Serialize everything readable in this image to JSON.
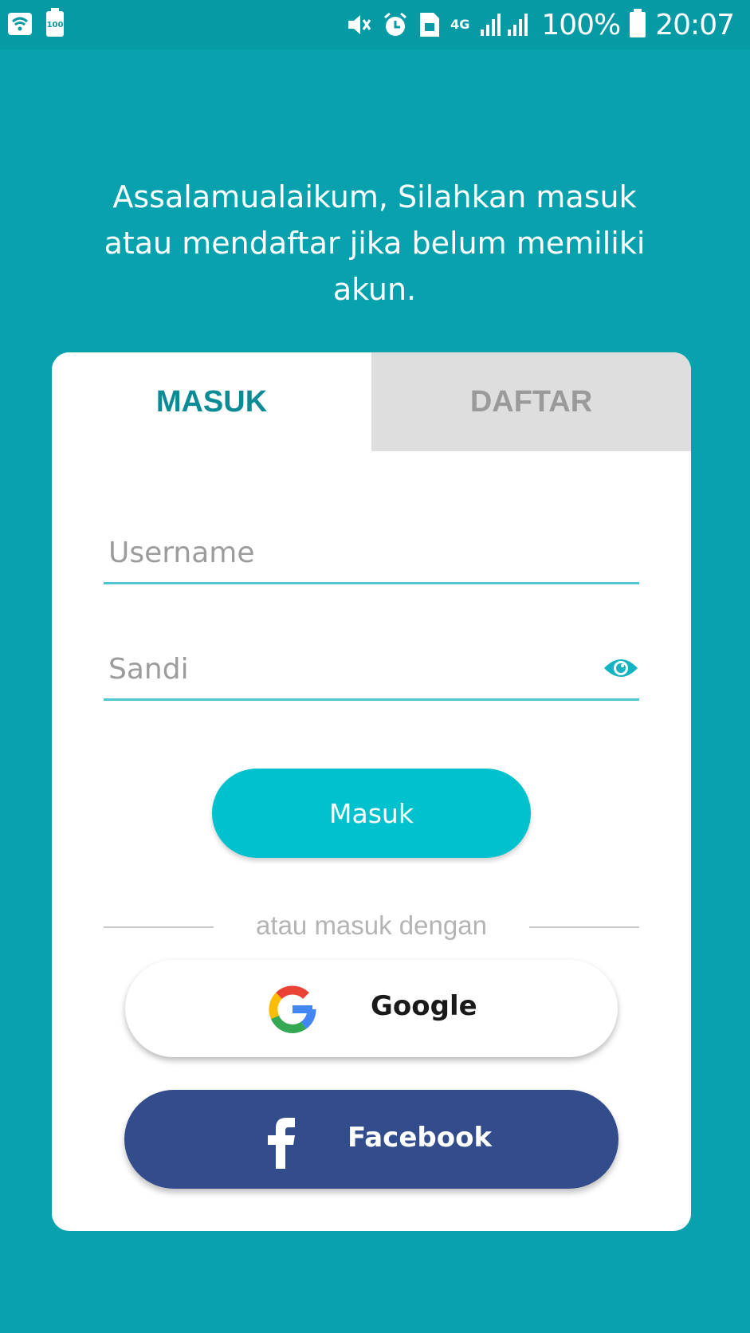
{
  "status_bar": {
    "battery_small": "100",
    "network": "4G",
    "battery_percent": "100%",
    "time": "20:07",
    "icons": [
      "wifi-icon",
      "battery-saver-icon",
      "mute-icon",
      "alarm-icon",
      "sim-card-icon",
      "signal-icon",
      "battery-icon"
    ]
  },
  "welcome_text": "Assalamualaikum, Silahkan masuk atau mendaftar jika belum memiliki akun.",
  "tabs": [
    {
      "label": "MASUK",
      "active": true
    },
    {
      "label": "DAFTAR",
      "active": false
    }
  ],
  "form": {
    "username": {
      "value": "",
      "placeholder": "Username"
    },
    "password": {
      "value": "",
      "placeholder": "Sandi"
    }
  },
  "buttons": {
    "login_label": "Masuk",
    "divider_text": "atau masuk dengan",
    "google_label": "Google",
    "facebook_label": "Facebook"
  },
  "colors": {
    "background": "#07a2ad",
    "accent": "#00c2ce",
    "tab_active_text": "#0b8b96",
    "facebook": "#334d8c"
  }
}
